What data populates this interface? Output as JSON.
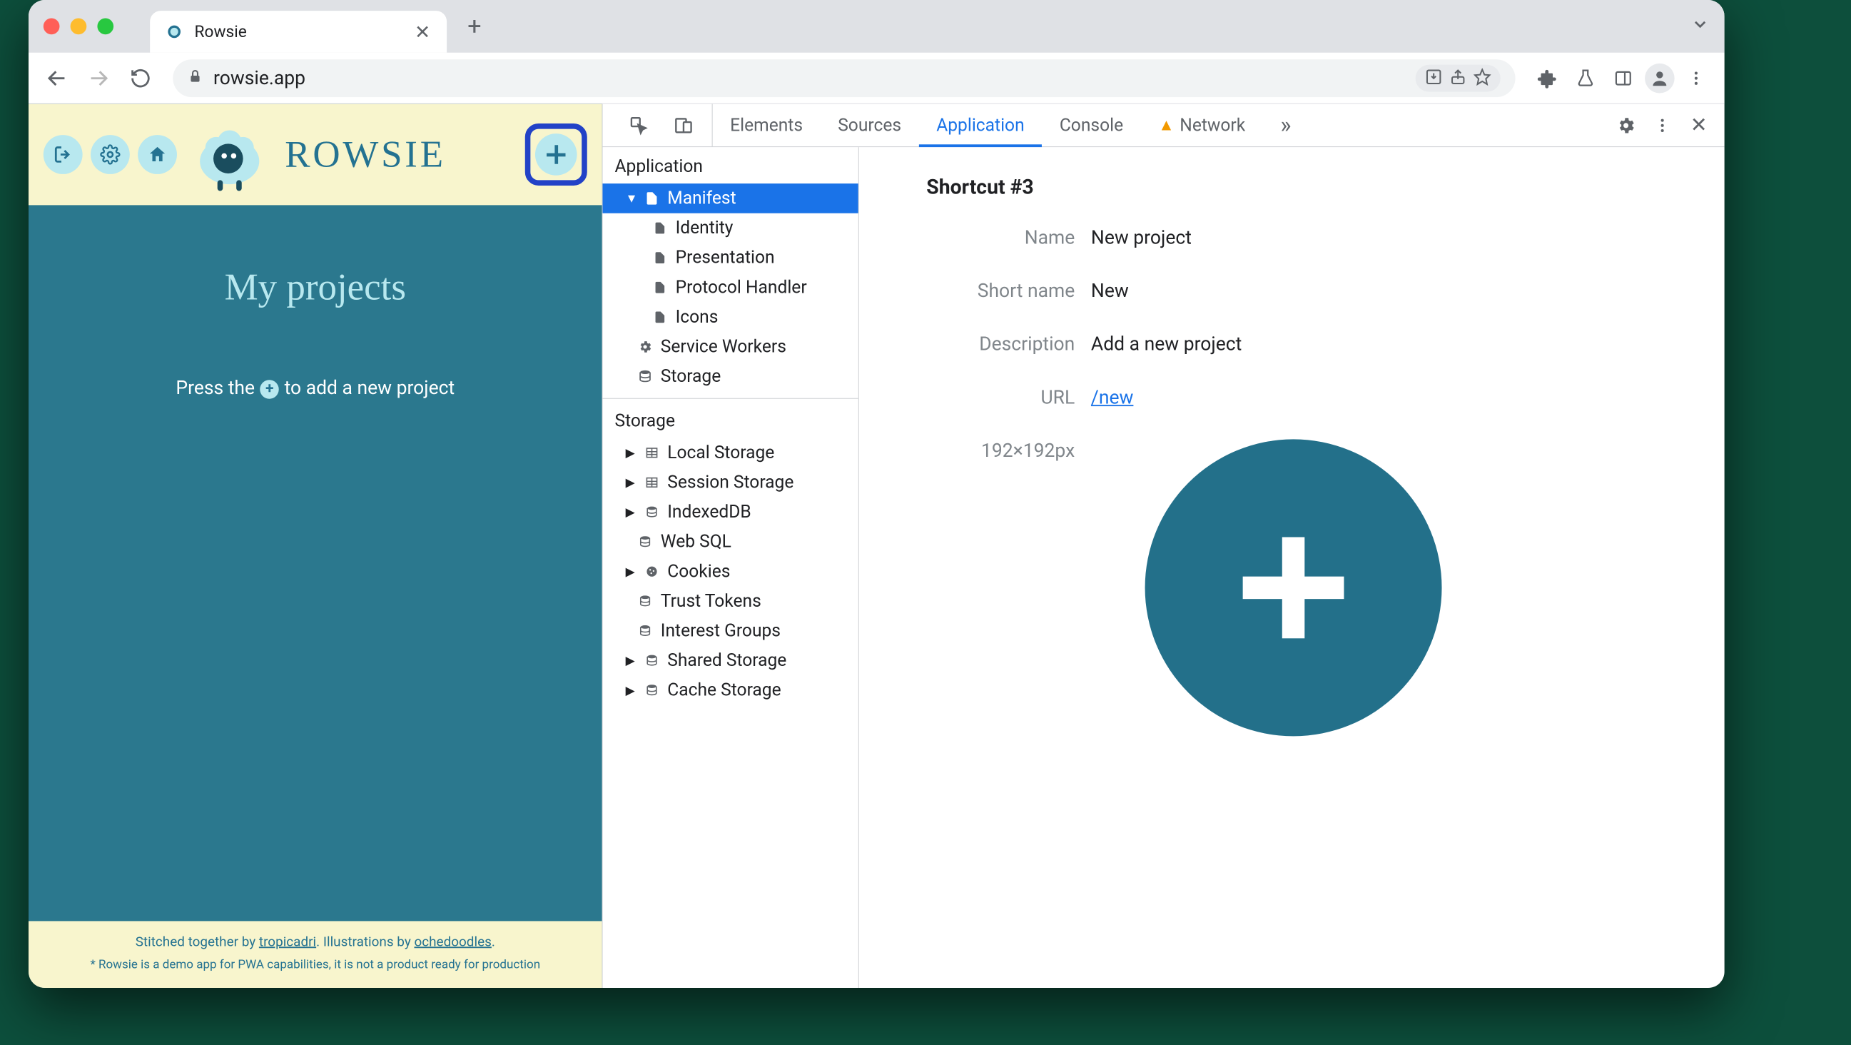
{
  "browser": {
    "tab_title": "Rowsie",
    "url": "rowsie.app"
  },
  "app": {
    "brand": "ROWSIE",
    "body_title": "My projects",
    "hint_pre": "Press the",
    "hint_post": "to add a new project",
    "footer_pre": "Stitched together by ",
    "footer_link1": "tropicadri",
    "footer_mid": ". Illustrations by ",
    "footer_link2": "ochedoodles",
    "footer_end": ".",
    "disclaimer": "* Rowsie is a demo app for PWA capabilities, it is not a product ready for production"
  },
  "devtools": {
    "tabs": {
      "elements": "Elements",
      "sources": "Sources",
      "application": "Application",
      "console": "Console",
      "network": "Network"
    },
    "sidebar": {
      "group_application": "Application",
      "manifest": "Manifest",
      "identity": "Identity",
      "presentation": "Presentation",
      "protocol_handler": "Protocol Handler",
      "icons": "Icons",
      "service_workers": "Service Workers",
      "storage_item": "Storage",
      "group_storage": "Storage",
      "local_storage": "Local Storage",
      "session_storage": "Session Storage",
      "indexeddb": "IndexedDB",
      "web_sql": "Web SQL",
      "cookies": "Cookies",
      "trust_tokens": "Trust Tokens",
      "interest_groups": "Interest Groups",
      "shared_storage": "Shared Storage",
      "cache_storage": "Cache Storage"
    },
    "detail": {
      "heading": "Shortcut #3",
      "name_key": "Name",
      "name_val": "New project",
      "shortname_key": "Short name",
      "shortname_val": "New",
      "desc_key": "Description",
      "desc_val": "Add a new project",
      "url_key": "URL",
      "url_val": "/new",
      "icon_dim": "192×192px"
    }
  }
}
